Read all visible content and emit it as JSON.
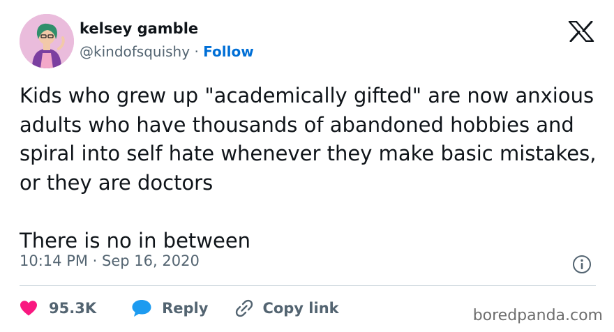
{
  "author": {
    "name": "kelsey gamble",
    "handle": "@kindofsquishy",
    "separator": "·",
    "follow_label": "Follow"
  },
  "platform_icon": "x-logo-icon",
  "tweet": {
    "text": "Kids who grew up \"academically gifted\" are now anxious adults who have thousands of abandoned hobbies and spiral into self hate whenever they make basic mistakes, or they are doctors\n\nThere is no in between",
    "time": "10:14 PM",
    "separator": "·",
    "date": "Sep 16, 2020"
  },
  "actions": {
    "like_count": "95.3K",
    "reply_label": "Reply",
    "copy_link_label": "Copy link"
  },
  "watermark": "boredpanda.com",
  "colors": {
    "text": "#0f1419",
    "secondary": "#536471",
    "link": "#006fd6",
    "like": "#f91880",
    "reply": "#1d9bf0",
    "divider": "#cfd9de"
  }
}
